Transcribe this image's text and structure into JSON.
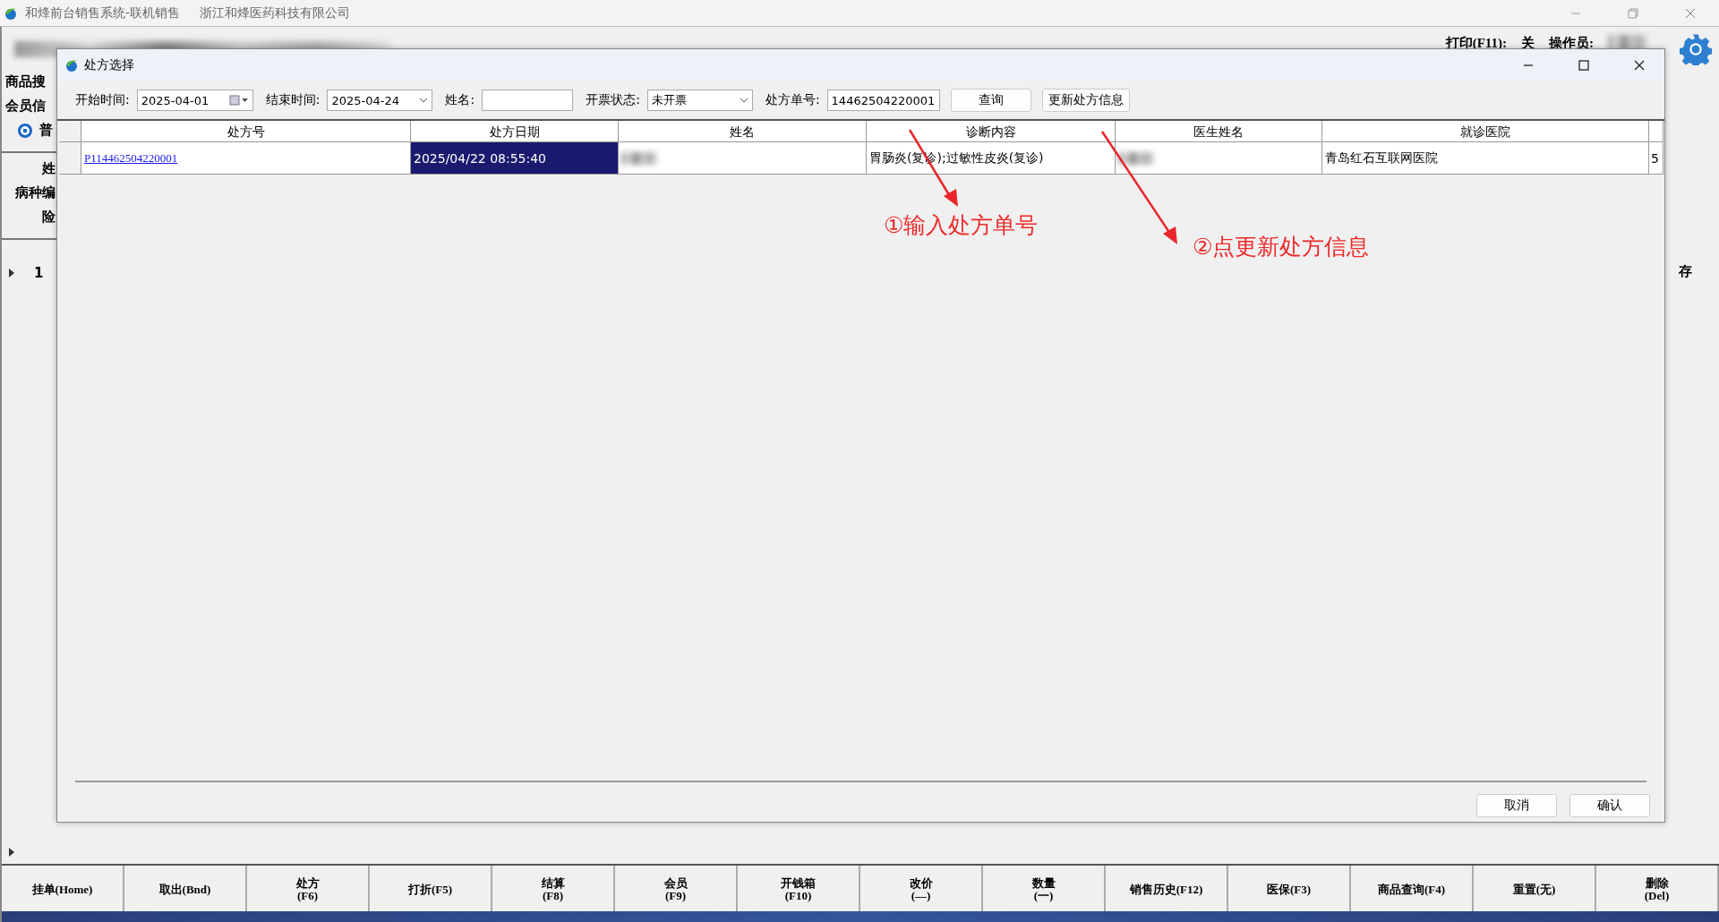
{
  "app_window": {
    "title": "和烽前台销售系统-联机销售",
    "company": "浙江和烽医药科技有限公司"
  },
  "header": {
    "print_label": "打印(F11):",
    "print_value": "关",
    "operator_label": "操作员:"
  },
  "left_panel": {
    "search_label": "商品搜",
    "member_label": "会员信",
    "radio": {
      "label": "普",
      "selected": true
    },
    "fields": [
      "姓",
      "病种编",
      "险"
    ]
  },
  "sales_grid": {
    "partial_column": "存",
    "row_number": "1"
  },
  "dialog": {
    "title": "处方选择",
    "filters": [
      {
        "label": "开始时间:",
        "value": "2025-04-01",
        "kind": "date"
      },
      {
        "label": "结束时间:",
        "value": "2025-04-24",
        "kind": "select"
      },
      {
        "label": "姓名:",
        "kind": "text"
      },
      {
        "label": "开票状态:",
        "value": "未开票",
        "kind": "select"
      },
      {
        "label": "处方单号:",
        "value": "14462504220001",
        "kind": "text"
      }
    ],
    "buttons": [
      "查询",
      "更新处方信息"
    ],
    "table": {
      "columns": [
        "处方号",
        "处方日期",
        "姓名",
        "诊断内容",
        "医生姓名",
        "就诊医院"
      ],
      "rows": [
        {
          "cells": [
            {
              "kind": "link",
              "text": "P114462504220001",
              "selected": false
            },
            {
              "kind": "text",
              "text": "2025/04/22 08:55:40",
              "selected": true
            },
            {
              "kind": "blurred",
              "selected": false
            },
            {
              "kind": "text",
              "text": "胃肠炎(复诊);过敏性皮炎(复诊)",
              "selected": false
            },
            {
              "kind": "blurred",
              "selected": false
            },
            {
              "kind": "text",
              "text": "青岛红石互联网医院",
              "selected": false
            },
            {
              "kind": "text",
              "text": "5",
              "selected": false
            }
          ]
        }
      ]
    },
    "annotations": [
      "①输入处方单号",
      "②点更新处方信息"
    ],
    "footer_buttons": [
      "取消",
      "确认"
    ]
  },
  "function_keys": [
    {
      "label": "挂单(Home)",
      "kind": "inline"
    },
    {
      "label": "取出(Bnd)",
      "kind": "inline"
    },
    {
      "label": "处方",
      "key": "(F6)",
      "kind": "stacked"
    },
    {
      "label": "打折(F5)",
      "kind": "inline"
    },
    {
      "label": "结算",
      "key": "(F8)",
      "kind": "stacked"
    },
    {
      "label": "会员",
      "key": "(F9)",
      "kind": "stacked"
    },
    {
      "label": "开钱箱",
      "key": "(F10)",
      "kind": "stacked"
    },
    {
      "label": "改价",
      "key": "(—)",
      "kind": "stacked"
    },
    {
      "label": "数量",
      "key": "(一)",
      "kind": "stacked"
    },
    {
      "label": "销售历史(F12)",
      "kind": "inline"
    },
    {
      "label": "医保(F3)",
      "kind": "inline"
    },
    {
      "label": "商品查询(F4)",
      "kind": "inline"
    },
    {
      "label": "重置(无)",
      "kind": "inline"
    },
    {
      "label": "删除",
      "key": "(Del)",
      "kind": "stacked"
    }
  ]
}
